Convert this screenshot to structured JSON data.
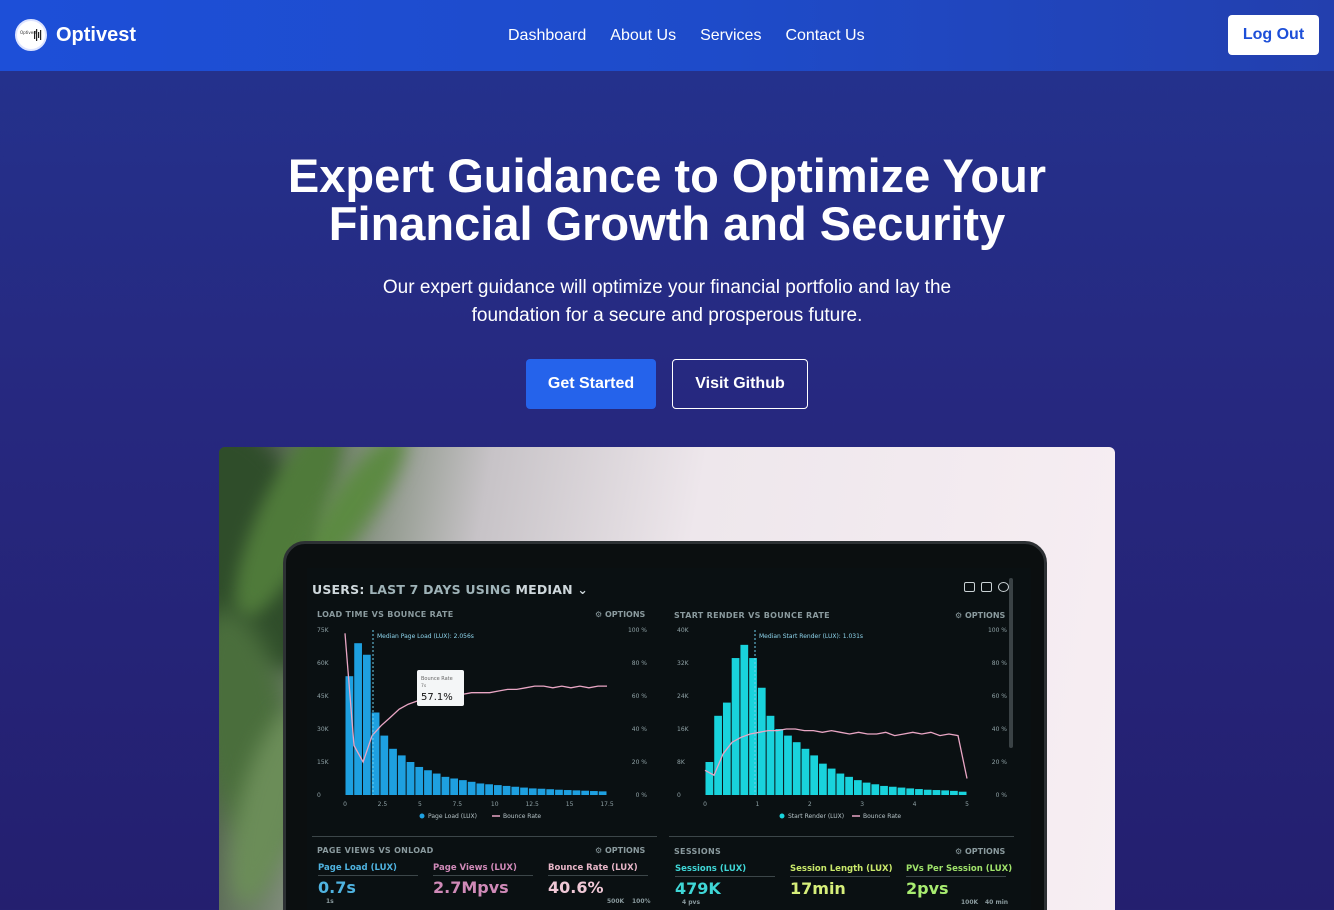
{
  "nav": {
    "brand": "Optivest",
    "logo_text": "Optivest",
    "links": [
      {
        "label": "Dashboard"
      },
      {
        "label": "About Us"
      },
      {
        "label": "Services"
      },
      {
        "label": "Contact Us"
      }
    ],
    "logout_label": "Log Out"
  },
  "hero": {
    "title_line1": "Expert Guidance to Optimize Your",
    "title_line2": "Financial Growth and Security",
    "subtitle_line1": "Our expert guidance will optimize your financial portfolio and lay the",
    "subtitle_line2": "foundation for a secure and prosperous future.",
    "cta_primary": "Get Started",
    "cta_secondary": "Visit Github"
  },
  "colors": {
    "nav_gradient_start": "#1d4fd8",
    "background": "#24338f",
    "primary_button": "#2563eb"
  },
  "screen": {
    "title_users": "USERS:",
    "title_range": "LAST 7 DAYS",
    "title_using": "USING",
    "title_median": "MEDIAN",
    "chart_left": {
      "title": "LOAD TIME VS BOUNCE RATE",
      "options": "⚙ OPTIONS",
      "median_label": "Median Page Load (LUX): 2.056s",
      "tooltip_label": "Bounce Rate",
      "tooltip_sub": "7s",
      "tooltip_value": "57.1%",
      "y_ticks": [
        "75K",
        "60K",
        "45K",
        "30K",
        "15K",
        "0"
      ],
      "y2_ticks": [
        "100 %",
        "80 %",
        "60 %",
        "40 %",
        "20 %",
        "0 %"
      ],
      "x_ticks": [
        "0",
        "2.5",
        "5",
        "7.5",
        "10",
        "12.5",
        "15",
        "17.5"
      ],
      "legend": [
        "Page Load (LUX)",
        "Bounce Rate"
      ]
    },
    "chart_right": {
      "title": "START RENDER VS BOUNCE RATE",
      "options": "⚙ OPTIONS",
      "median_label": "Median Start Render (LUX): 1.031s",
      "y_ticks": [
        "40K",
        "32K",
        "24K",
        "16K",
        "8K",
        "0"
      ],
      "y2_ticks": [
        "100 %",
        "80 %",
        "60 %",
        "40 %",
        "20 %",
        "0 %"
      ],
      "x_ticks": [
        "0",
        "1",
        "2",
        "3",
        "4",
        "5"
      ],
      "legend": [
        "Start Render (LUX)",
        "Bounce Rate"
      ]
    },
    "page_views": {
      "title": "PAGE VIEWS VS ONLOAD",
      "options": "⚙ OPTIONS",
      "metrics": [
        {
          "label": "Page Load (LUX)",
          "value": "0.7s"
        },
        {
          "label": "Page Views (LUX)",
          "value": "2.7Mpvs"
        },
        {
          "label": "Bounce Rate (LUX)",
          "value": "40.6%"
        }
      ],
      "foot_left": "1s",
      "foot_right1": "500K",
      "foot_right2": "100%"
    },
    "sessions": {
      "title": "SESSIONS",
      "options": "⚙ OPTIONS",
      "metrics": [
        {
          "label": "Sessions (LUX)",
          "value": "479K"
        },
        {
          "label": "Session Length (LUX)",
          "value": "17min"
        },
        {
          "label": "PVs Per Session (LUX)",
          "value": "2pvs"
        }
      ],
      "foot_left": "4 pvs",
      "foot_right1": "100K",
      "foot_right2": "40 min"
    }
  }
}
